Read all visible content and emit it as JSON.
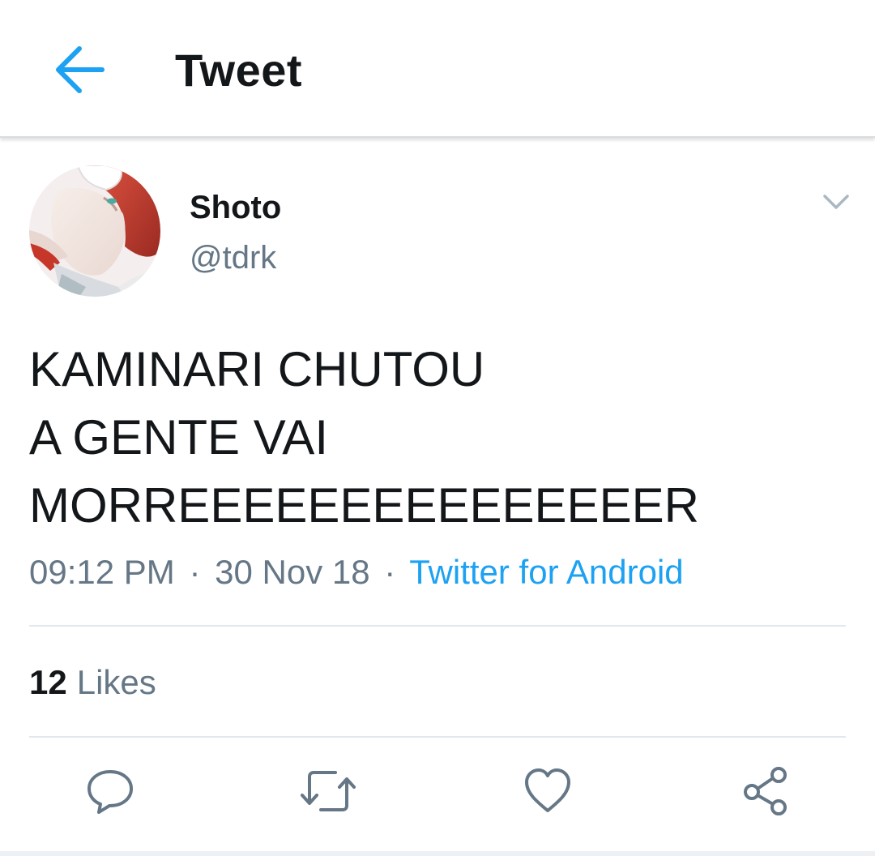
{
  "header": {
    "title": "Tweet",
    "back_icon": "arrow-left-icon",
    "accent_color": "#1da1f2"
  },
  "tweet": {
    "author": {
      "display_name": "Shoto",
      "handle": "@tdrk",
      "avatar": "profile-photo"
    },
    "menu_icon": "chevron-down-icon",
    "text_lines": [
      "KAMINARI CHUTOU",
      "A GENTE VAI",
      "MORREEEEEEEEEEEEEEER"
    ],
    "time": "09:12 PM",
    "separator": "·",
    "date": "30 Nov 18",
    "source": "Twitter for Android",
    "likes": {
      "count": "12",
      "label": "Likes"
    }
  },
  "actions": [
    {
      "name": "reply",
      "icon": "reply-icon"
    },
    {
      "name": "retweet",
      "icon": "retweet-icon"
    },
    {
      "name": "like",
      "icon": "heart-icon"
    },
    {
      "name": "share",
      "icon": "share-icon"
    }
  ],
  "colors": {
    "text": "#14171a",
    "secondary": "#657786",
    "link": "#1da1f2",
    "divider": "#e1e8ed"
  }
}
